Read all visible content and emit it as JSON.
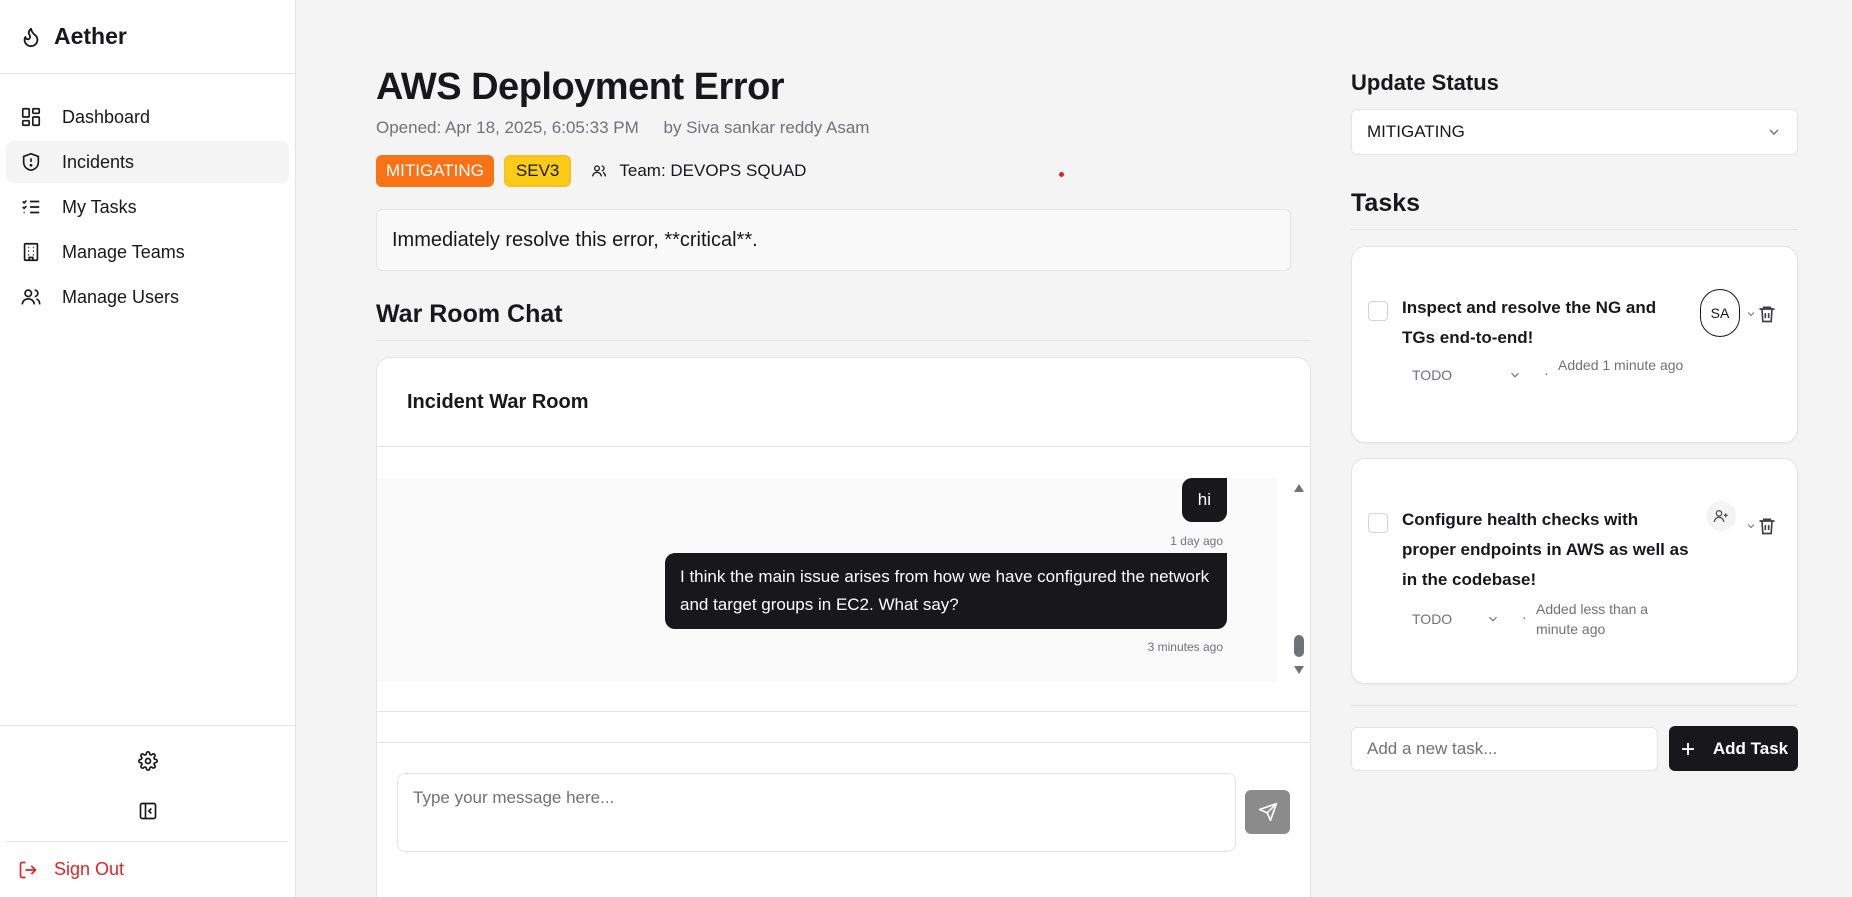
{
  "app": {
    "name": "Aether"
  },
  "nav": [
    {
      "label": "Dashboard",
      "icon": "dashboard-icon"
    },
    {
      "label": "Incidents",
      "icon": "shield-icon",
      "active": true
    },
    {
      "label": "My Tasks",
      "icon": "list-check-icon"
    },
    {
      "label": "Manage Teams",
      "icon": "building-icon"
    },
    {
      "label": "Manage Users",
      "icon": "users-icon"
    }
  ],
  "signout": "Sign Out",
  "incident": {
    "title": "AWS Deployment Error",
    "opened": "Opened: Apr 18, 2025, 6:05:33 PM",
    "by": "by Siva sankar reddy Asam",
    "status": "MITIGATING",
    "severity": "SEV3",
    "team": "Team: DEVOPS SQUAD",
    "description": "Immediately resolve this error, **critical**."
  },
  "chat": {
    "section_title": "War Room Chat",
    "room_title": "Incident War Room",
    "messages": [
      {
        "text": "hi",
        "time": "1 day ago"
      },
      {
        "text": "I think the main issue arises from how we have configured the network and target groups in EC2. What say?",
        "time": "3 minutes ago"
      }
    ],
    "placeholder": "Type your message here..."
  },
  "status_panel": {
    "title": "Update Status",
    "selected": "MITIGATING"
  },
  "tasks": {
    "title": "Tasks",
    "items": [
      {
        "title": "Inspect and resolve the NG and TGs end-to-end!",
        "status": "TODO",
        "added": "Added 1 minute ago",
        "assignee": "SA"
      },
      {
        "title": "Configure health checks with proper endpoints in AWS as well as in the codebase!",
        "status": "TODO",
        "added": "Added less than a minute ago",
        "assignee": ""
      }
    ],
    "new_placeholder": "Add a new task...",
    "add_label": "Add Task"
  },
  "colors": {
    "accent": "#18181b",
    "mitigating": "#f97316",
    "sev3": "#facc15",
    "danger": "#dc2626"
  }
}
